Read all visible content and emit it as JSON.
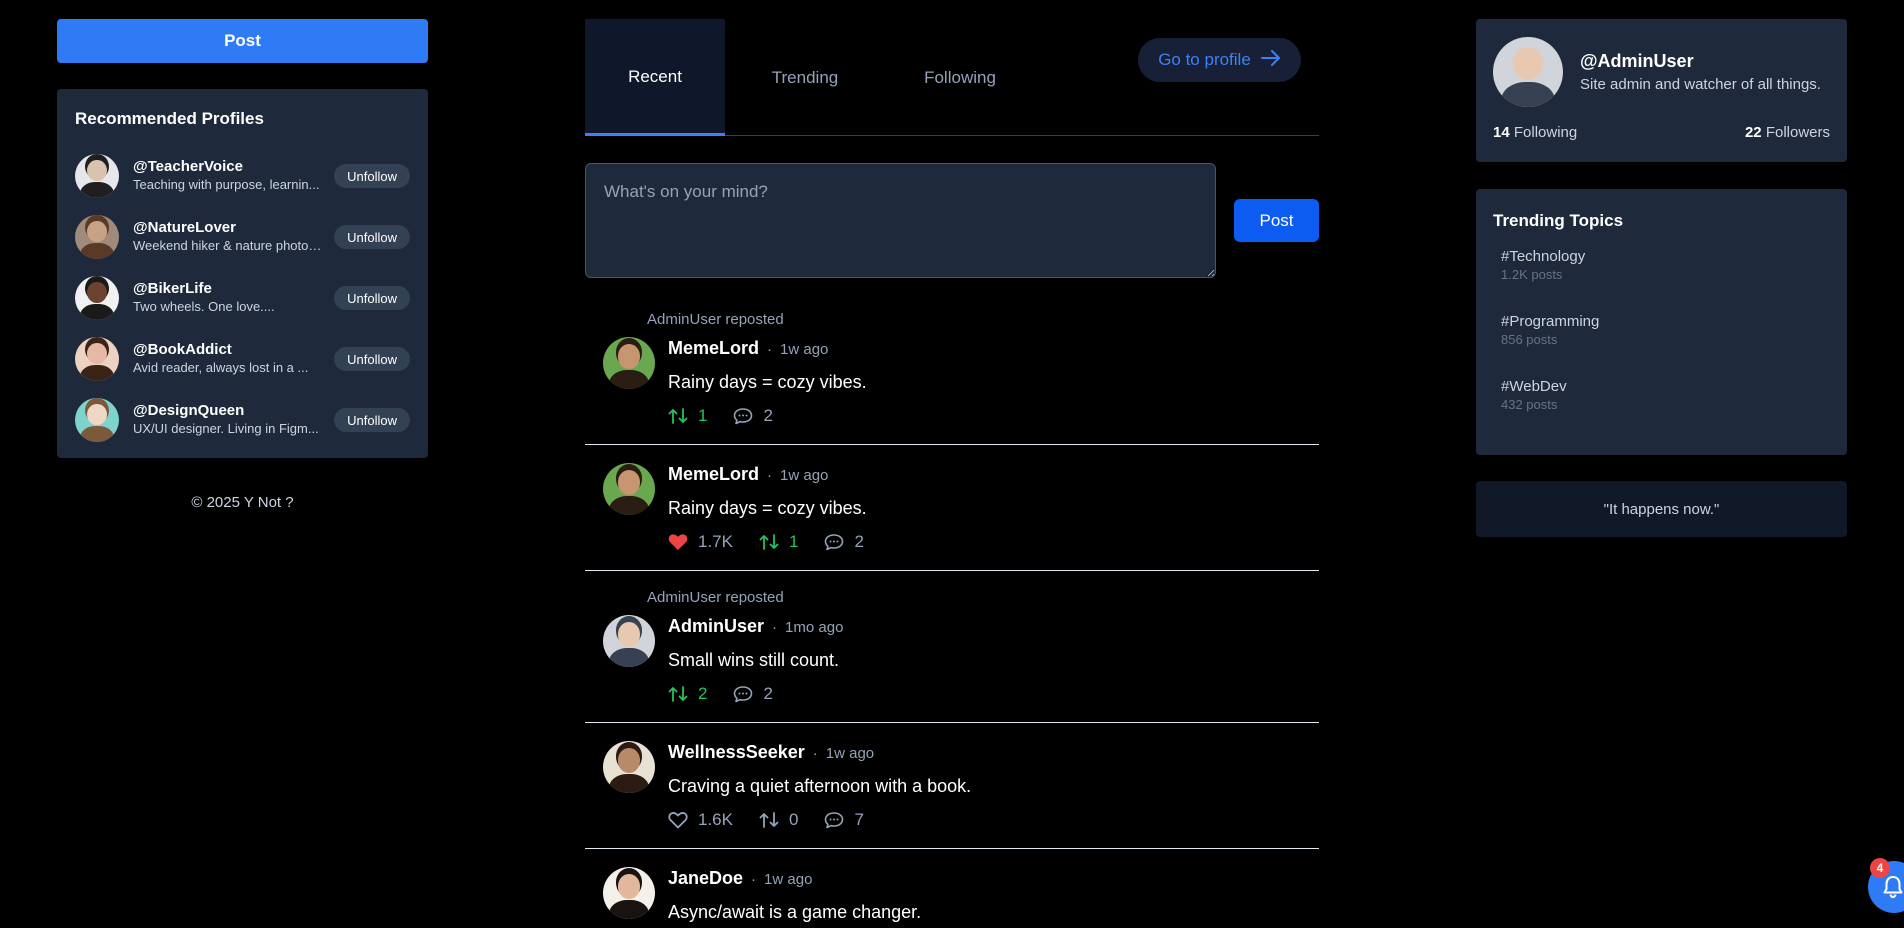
{
  "left": {
    "post_button": "Post",
    "recommended": {
      "title": "Recommended Profiles",
      "unfollow_label": "Unfollow",
      "profiles": [
        {
          "handle": "@TeacherVoice",
          "bio": "Teaching with purpose, learnin...",
          "skin": "#d9c3b0",
          "hair": "#1f1f1f",
          "bg": "#e5e7eb"
        },
        {
          "handle": "@NatureLover",
          "bio": "Weekend hiker & nature photogr...",
          "skin": "#c9a184",
          "hair": "#5a3a26",
          "bg": "#a08a7a"
        },
        {
          "handle": "@BikerLife",
          "bio": "Two wheels. One love....",
          "skin": "#6b4330",
          "hair": "#1a1a1a",
          "bg": "#f1f1f1"
        },
        {
          "handle": "@BookAddict",
          "bio": "Avid reader, always lost in a ...",
          "skin": "#e6b9a6",
          "hair": "#3a2418",
          "bg": "#ecd2c2"
        },
        {
          "handle": "@DesignQueen",
          "bio": "UX/UI designer. Living in Figm...",
          "skin": "#f0d6c5",
          "hair": "#7a5a3a",
          "bg": "#7fd3cf"
        }
      ]
    },
    "copyright": "© 2025 Y Not ?"
  },
  "center": {
    "tabs": [
      "Recent",
      "Trending",
      "Following"
    ],
    "active_tab": "Recent",
    "goto_profile": "Go to profile",
    "composer_placeholder": "What's on your mind?",
    "composer_post": "Post",
    "posts": [
      {
        "repost": "AdminUser reposted",
        "author": "MemeLord",
        "time": "1w ago",
        "text": "Rainy days = cozy vibes.",
        "likes": null,
        "reposts": "1",
        "comments": "2",
        "reposted_by_me": true
      },
      {
        "repost": null,
        "author": "MemeLord",
        "time": "1w ago",
        "text": "Rainy days = cozy vibes.",
        "likes": "1.7K",
        "liked": true,
        "reposts": "1",
        "comments": "2",
        "reposted_by_me": true
      },
      {
        "repost": "AdminUser reposted",
        "author": "AdminUser",
        "time": "1mo ago",
        "text": "Small wins still count.",
        "likes": null,
        "reposts": "2",
        "comments": "2",
        "reposted_by_me": true
      },
      {
        "repost": null,
        "author": "WellnessSeeker",
        "time": "1w ago",
        "text": "Craving a quiet afternoon with a book.",
        "likes": "1.6K",
        "liked": false,
        "reposts": "0",
        "comments": "7",
        "reposted_by_me": false
      },
      {
        "repost": null,
        "author": "JaneDoe",
        "time": "1w ago",
        "text": "Async/await is a game changer.",
        "likes": null,
        "reposts": null,
        "comments": null,
        "reposted_by_me": false
      }
    ],
    "separator": "·"
  },
  "right": {
    "profile": {
      "handle": "@AdminUser",
      "bio": "Site admin and watcher of all things.",
      "following_count": "14",
      "following_label": "Following",
      "followers_count": "22",
      "followers_label": "Followers"
    },
    "trending": {
      "title": "Trending Topics",
      "topics": [
        {
          "tag": "#Technology",
          "count": "1.2K posts"
        },
        {
          "tag": "#Programming",
          "count": "856 posts"
        },
        {
          "tag": "#WebDev",
          "count": "432 posts"
        }
      ]
    },
    "quote": "\"It happens now.\""
  },
  "notifications": {
    "badge": "4"
  },
  "colors": {
    "accent": "#2f7bf5",
    "card": "#1e293b",
    "repost_green": "#22c55e",
    "like_red": "#ef4444"
  }
}
